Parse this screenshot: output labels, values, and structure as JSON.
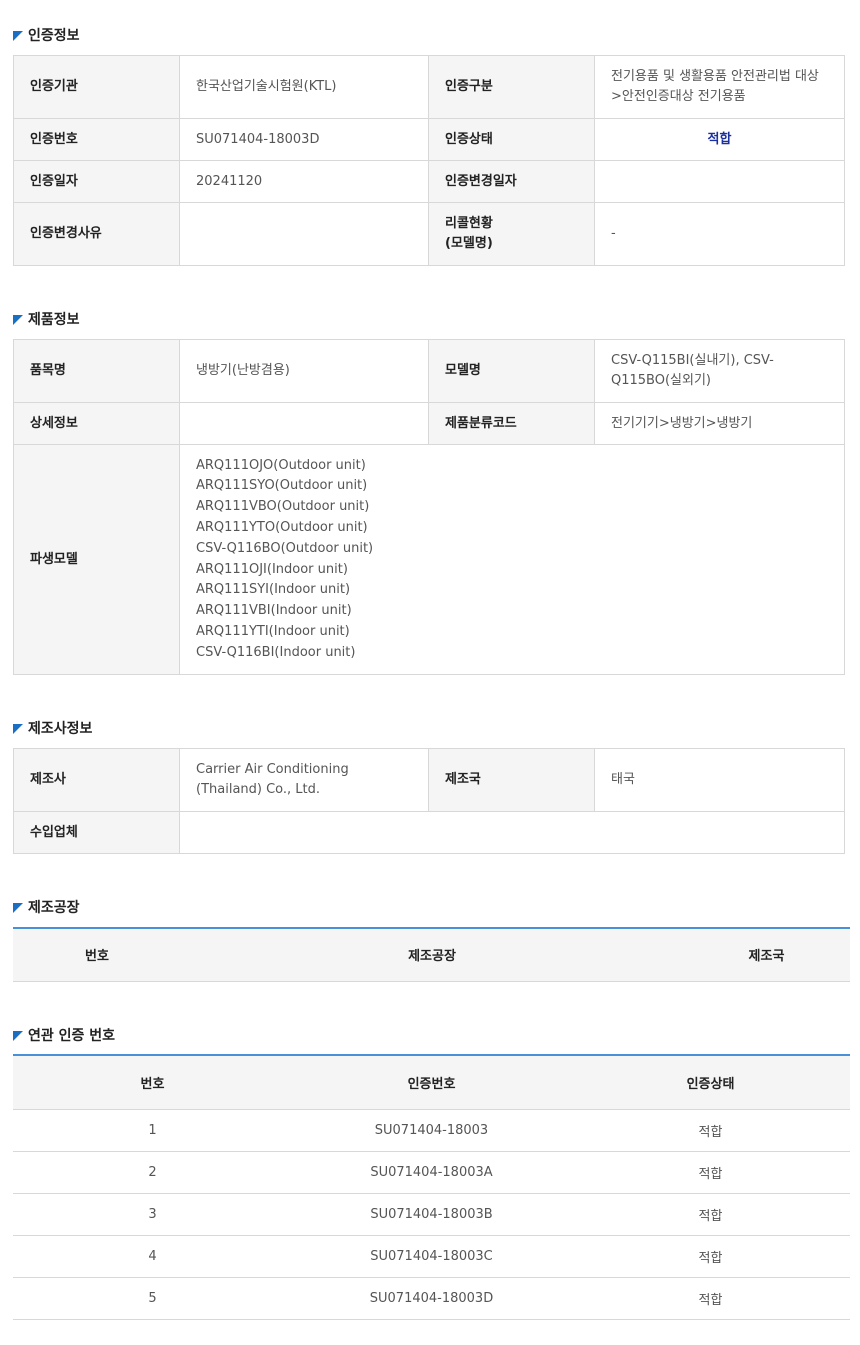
{
  "cert_section": {
    "title": "인증정보",
    "agency_label": "인증기관",
    "agency_value": "한국산업기술시험원(KTL)",
    "category_label": "인증구분",
    "category_value": "전기용품 및 생활용품 안전관리법 대상 >안전인증대상 전기용품",
    "number_label": "인증번호",
    "number_value": "SU071404-18003D",
    "status_label": "인증상태",
    "status_value": "적합",
    "date_label": "인증일자",
    "date_value": "20241120",
    "change_date_label": "인증변경일자",
    "change_date_value": "",
    "change_reason_label": "인증변경사유",
    "change_reason_value": "",
    "recall_label": "리콜현황\n(모델명)",
    "recall_value": "-"
  },
  "product_section": {
    "title": "제품정보",
    "item_label": "품목명",
    "item_value": "냉방기(난방겸용)",
    "model_label": "모델명",
    "model_value": "CSV-Q115BI(실내기), CSV-Q115BO(실외기)",
    "detail_label": "상세정보",
    "detail_value": "",
    "class_code_label": "제품분류코드",
    "class_code_value": "전기기기>냉방기>냉방기",
    "derived_label": "파생모델",
    "derived_models": [
      "ARQ111OJO(Outdoor unit)",
      "ARQ111SYO(Outdoor unit)",
      "ARQ111VBO(Outdoor unit)",
      "ARQ111YTO(Outdoor unit)",
      "CSV-Q116BO(Outdoor unit)",
      "ARQ111OJI(Indoor unit)",
      "ARQ111SYI(Indoor unit)",
      "ARQ111VBI(Indoor unit)",
      "ARQ111YTI(Indoor unit)",
      "CSV-Q116BI(Indoor unit)"
    ]
  },
  "maker_section": {
    "title": "제조사정보",
    "maker_label": "제조사",
    "maker_value": "Carrier Air Conditioning (Thailand) Co., Ltd.",
    "country_label": "제조국",
    "country_value": "태국",
    "importer_label": "수입업체",
    "importer_value": ""
  },
  "factory_section": {
    "title": "제조공장",
    "headers": {
      "no": "번호",
      "factory": "제조공장",
      "country": "제조국"
    }
  },
  "related_section": {
    "title": "연관 인증 번호",
    "headers": {
      "no": "번호",
      "cert_no": "인증번호",
      "status": "인증상태"
    },
    "rows": [
      {
        "no": "1",
        "cert_no": "SU071404-18003",
        "status": "적합"
      },
      {
        "no": "2",
        "cert_no": "SU071404-18003A",
        "status": "적합"
      },
      {
        "no": "3",
        "cert_no": "SU071404-18003B",
        "status": "적합"
      },
      {
        "no": "4",
        "cert_no": "SU071404-18003C",
        "status": "적합"
      },
      {
        "no": "5",
        "cert_no": "SU071404-18003D",
        "status": "적합"
      }
    ]
  },
  "colors": {
    "accent": "#1a6fc2",
    "status_ok": "#1a2fa0",
    "header_bg": "#f5f5f5",
    "border": "#d8d8d8",
    "list_top": "#4a90d9"
  }
}
